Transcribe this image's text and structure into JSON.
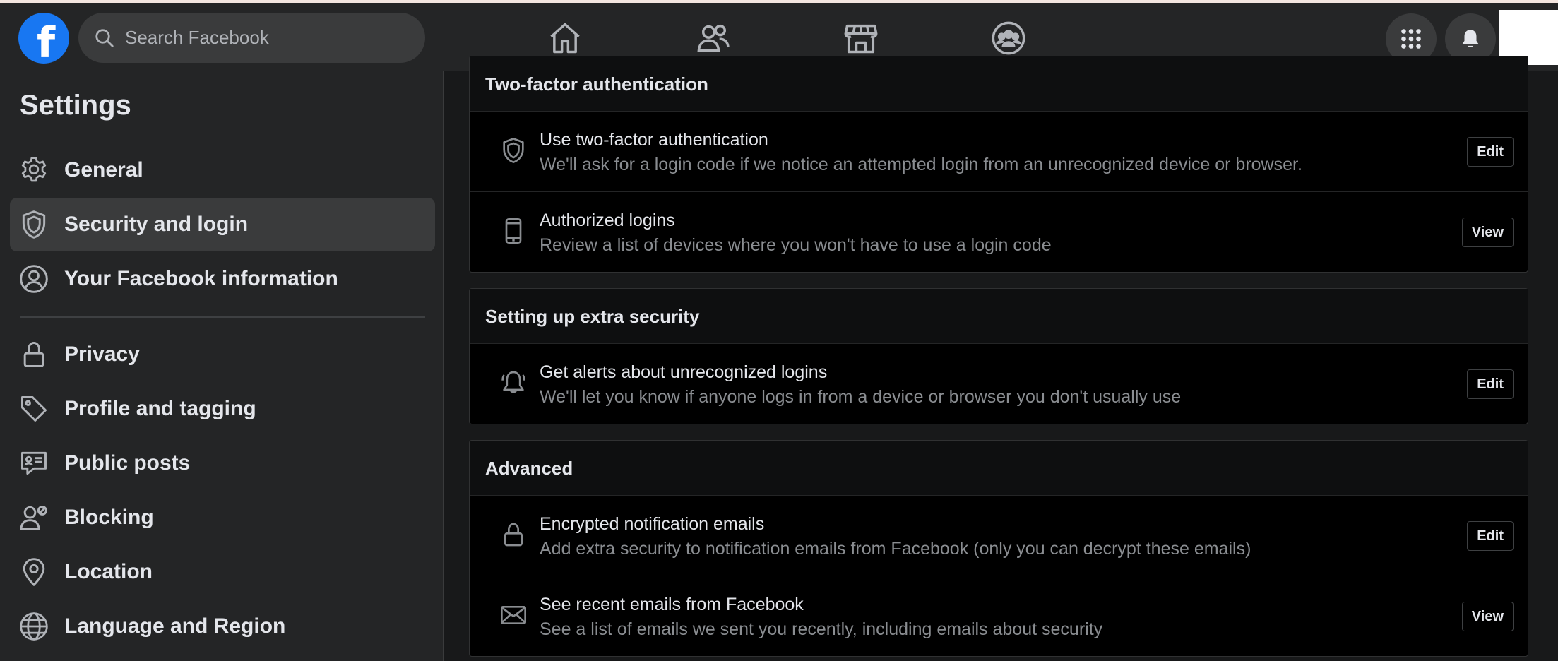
{
  "topbar": {
    "logo_letter": "f",
    "search_placeholder": "Search Facebook",
    "nav_icons": [
      "home-icon",
      "friends-icon",
      "marketplace-icon",
      "groups-icon"
    ],
    "right_icons": [
      "menu-grid-icon",
      "notifications-bell-icon"
    ]
  },
  "sidebar": {
    "title": "Settings",
    "items": [
      {
        "label": "General",
        "icon": "gear-icon"
      },
      {
        "label": "Security and login",
        "icon": "shield-icon",
        "active": true
      },
      {
        "label": "Your Facebook information",
        "icon": "user-circle-icon"
      },
      {
        "label": "Privacy",
        "icon": "lock-icon"
      },
      {
        "label": "Profile and tagging",
        "icon": "tag-icon"
      },
      {
        "label": "Public posts",
        "icon": "public-posts-icon"
      },
      {
        "label": "Blocking",
        "icon": "blocking-icon"
      },
      {
        "label": "Location",
        "icon": "location-pin-icon"
      },
      {
        "label": "Language and Region",
        "icon": "globe-icon"
      }
    ]
  },
  "sections": [
    {
      "heading": "Two-factor authentication",
      "rows": [
        {
          "title": "Use two-factor authentication",
          "desc": "We'll ask for a login code if we notice an attempted login from an unrecognized device or browser.",
          "action": "Edit",
          "icon": "shield-icon"
        },
        {
          "title": "Authorized logins",
          "desc": "Review a list of devices where you won't have to use a login code",
          "action": "View",
          "icon": "phone-icon"
        }
      ]
    },
    {
      "heading": "Setting up extra security",
      "rows": [
        {
          "title": "Get alerts about unrecognized logins",
          "desc": "We'll let you know if anyone logs in from a device or browser you don't usually use",
          "action": "Edit",
          "icon": "bell-icon"
        }
      ]
    },
    {
      "heading": "Advanced",
      "rows": [
        {
          "title": "Encrypted notification emails",
          "desc": "Add extra security to notification emails from Facebook (only you can decrypt these emails)",
          "action": "Edit",
          "icon": "lock-icon"
        },
        {
          "title": "See recent emails from Facebook",
          "desc": "See a list of emails we sent you recently, including emails about security",
          "action": "View",
          "icon": "envelope-icon"
        }
      ]
    }
  ],
  "colors": {
    "brand": "#1877f2",
    "topbar_bg": "#242526",
    "content_bg": "#18191a",
    "card_bg": "#000000",
    "primary_text": "#e4e6eb",
    "secondary_text": "#8a8d91"
  }
}
